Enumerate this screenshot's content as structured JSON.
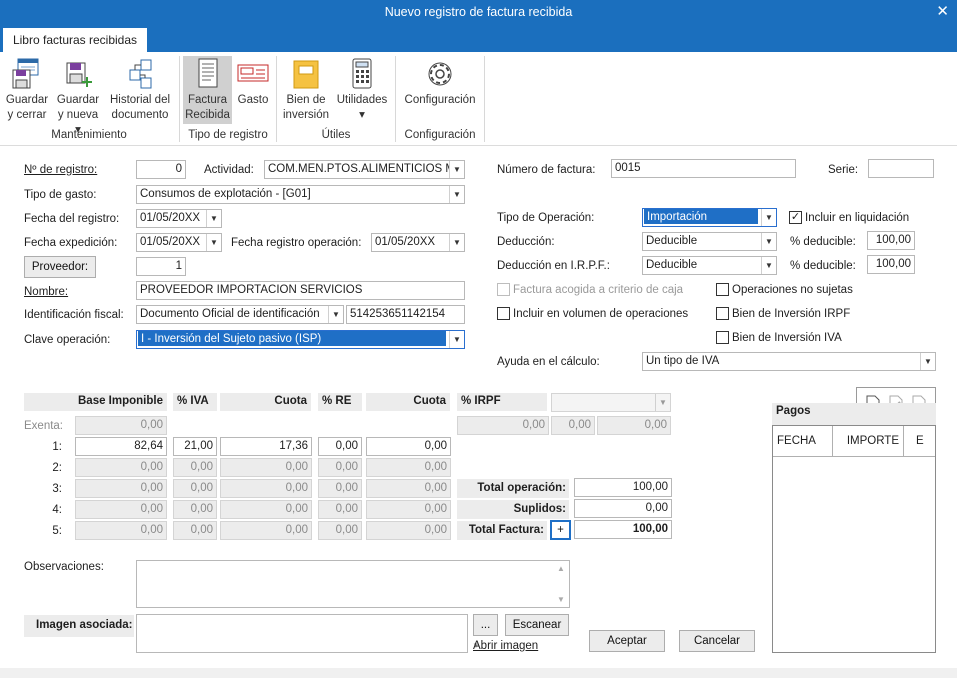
{
  "window": {
    "title": "Nuevo registro de factura recibida",
    "close_glyph": "✕"
  },
  "tab": {
    "label": "Libro facturas recibidas"
  },
  "ribbon": {
    "buttons": [
      {
        "line1": "Guardar",
        "line2": "y cerrar",
        "icon": "save-close-icon"
      },
      {
        "line1": "Guardar",
        "line2": "y nueva ▾",
        "icon": "save-new-icon"
      },
      {
        "line1": "Historial del",
        "line2": "documento",
        "icon": "history-icon"
      },
      {
        "line1": "Factura",
        "line2": "Recibida",
        "icon": "invoice-icon",
        "active": true
      },
      {
        "line1": "Gasto",
        "line2": "",
        "icon": "expense-icon"
      },
      {
        "line1": "Bien de",
        "line2": "inversión",
        "icon": "investment-folder-icon"
      },
      {
        "line1": "Utilidades",
        "line2": "▾",
        "icon": "calculator-icon"
      },
      {
        "line1": "Configuración",
        "line2": "",
        "icon": "gear-icon"
      }
    ],
    "groups": [
      "Mantenimiento",
      "Tipo de registro",
      "Útiles",
      "Configuración"
    ]
  },
  "form": {
    "num_registro_label": "Nº de registro:",
    "num_registro": "0",
    "actividad_label": "Actividad:",
    "actividad": "COM.MEN.PTOS.ALIMENTICIOS ME",
    "tipo_gasto_label": "Tipo de gasto:",
    "tipo_gasto": "Consumos de explotación - [G01]",
    "fecha_registro_label": "Fecha del registro:",
    "fecha_registro": "01/05/20XX",
    "fecha_expedicion_label": "Fecha expedición:",
    "fecha_expedicion": "01/05/20XX",
    "fecha_reg_operacion_label": "Fecha registro operación:",
    "fecha_reg_operacion": "01/05/20XX",
    "proveedor_button": "Proveedor:",
    "proveedor": "1",
    "nombre_label": "Nombre:",
    "nombre": "PROVEEDOR IMPORTACION SERVICIOS",
    "ident_fiscal_label": "Identificación fiscal:",
    "ident_fiscal_tipo": "Documento Oficial de identificación",
    "ident_fiscal_num": "514253651142154",
    "clave_operacion_label": "Clave operación:",
    "clave_operacion": "I - Inversión del Sujeto pasivo (ISP)",
    "num_factura_label": "Número de factura:",
    "num_factura": "0015",
    "serie_label": "Serie:",
    "serie": "",
    "tipo_operacion_label": "Tipo de Operación:",
    "tipo_operacion": "Importación",
    "incluir_liquidacion_label": "Incluir en liquidación",
    "incluir_liquidacion": true,
    "deduccion_label": "Deducción:",
    "deduccion": "Deducible",
    "pct_deducible_label": "% deducible:",
    "pct_deducible": "100,00",
    "deduccion_irpf_label": "Deducción en I.R.P.F.:",
    "deduccion_irpf": "Deducible",
    "pct_deducible_irpf": "100,00",
    "criterio_caja_label": "Factura acogida a criterio de caja",
    "op_no_sujetas_label": "Operaciones no sujetas",
    "volumen_label": "Incluir en  volumen de operaciones",
    "bien_irpf_label": "Bien de Inversión IRPF",
    "bien_iva_label": "Bien de Inversión IVA",
    "ayuda_label": "Ayuda en el cálculo:",
    "ayuda": "Un tipo de IVA",
    "observaciones_label": "Observaciones:",
    "imagen_label": "Imagen asociada:",
    "browse_button": "...",
    "escanear_button": "Escanear",
    "abrir_imagen_link": "Abrir imagen",
    "aceptar_button": "Aceptar",
    "cancelar_button": "Cancelar"
  },
  "tax_table": {
    "headers": [
      "Base Imponible",
      "% IVA",
      "Cuota",
      "% RE",
      "Cuota",
      "% IRPF"
    ],
    "exenta_label": "Exenta:",
    "exenta": "0,00",
    "irpf_values": [
      "0,00",
      "0,00",
      "0,00"
    ],
    "rows": [
      {
        "label": "1:",
        "base": "82,64",
        "iva": "21,00",
        "cuota": "17,36",
        "re": "0,00",
        "cuota_re": "0,00"
      },
      {
        "label": "2:",
        "base": "0,00",
        "iva": "0,00",
        "cuota": "0,00",
        "re": "0,00",
        "cuota_re": "0,00"
      },
      {
        "label": "3:",
        "base": "0,00",
        "iva": "0,00",
        "cuota": "0,00",
        "re": "0,00",
        "cuota_re": "0,00"
      },
      {
        "label": "4:",
        "base": "0,00",
        "iva": "0,00",
        "cuota": "0,00",
        "re": "0,00",
        "cuota_re": "0,00"
      },
      {
        "label": "5:",
        "base": "0,00",
        "iva": "0,00",
        "cuota": "0,00",
        "re": "0,00",
        "cuota_re": "0,00"
      }
    ],
    "total_operacion_label": "Total operación:",
    "total_operacion": "100,00",
    "suplidos_label": "Suplidos:",
    "suplidos": "0,00",
    "total_factura_label": "Total Factura:",
    "total_factura_button": "+",
    "total_factura": "100,00"
  },
  "pagos": {
    "title": "Pagos",
    "columns": [
      "FECHA",
      "IMPORTE",
      "E"
    ],
    "toolbar_icons": [
      "new-document-icon",
      "edit-document-icon",
      "delete-document-icon"
    ]
  },
  "colors": {
    "titlebar": "#1b6fbe",
    "selection": "#1f6fc6"
  }
}
